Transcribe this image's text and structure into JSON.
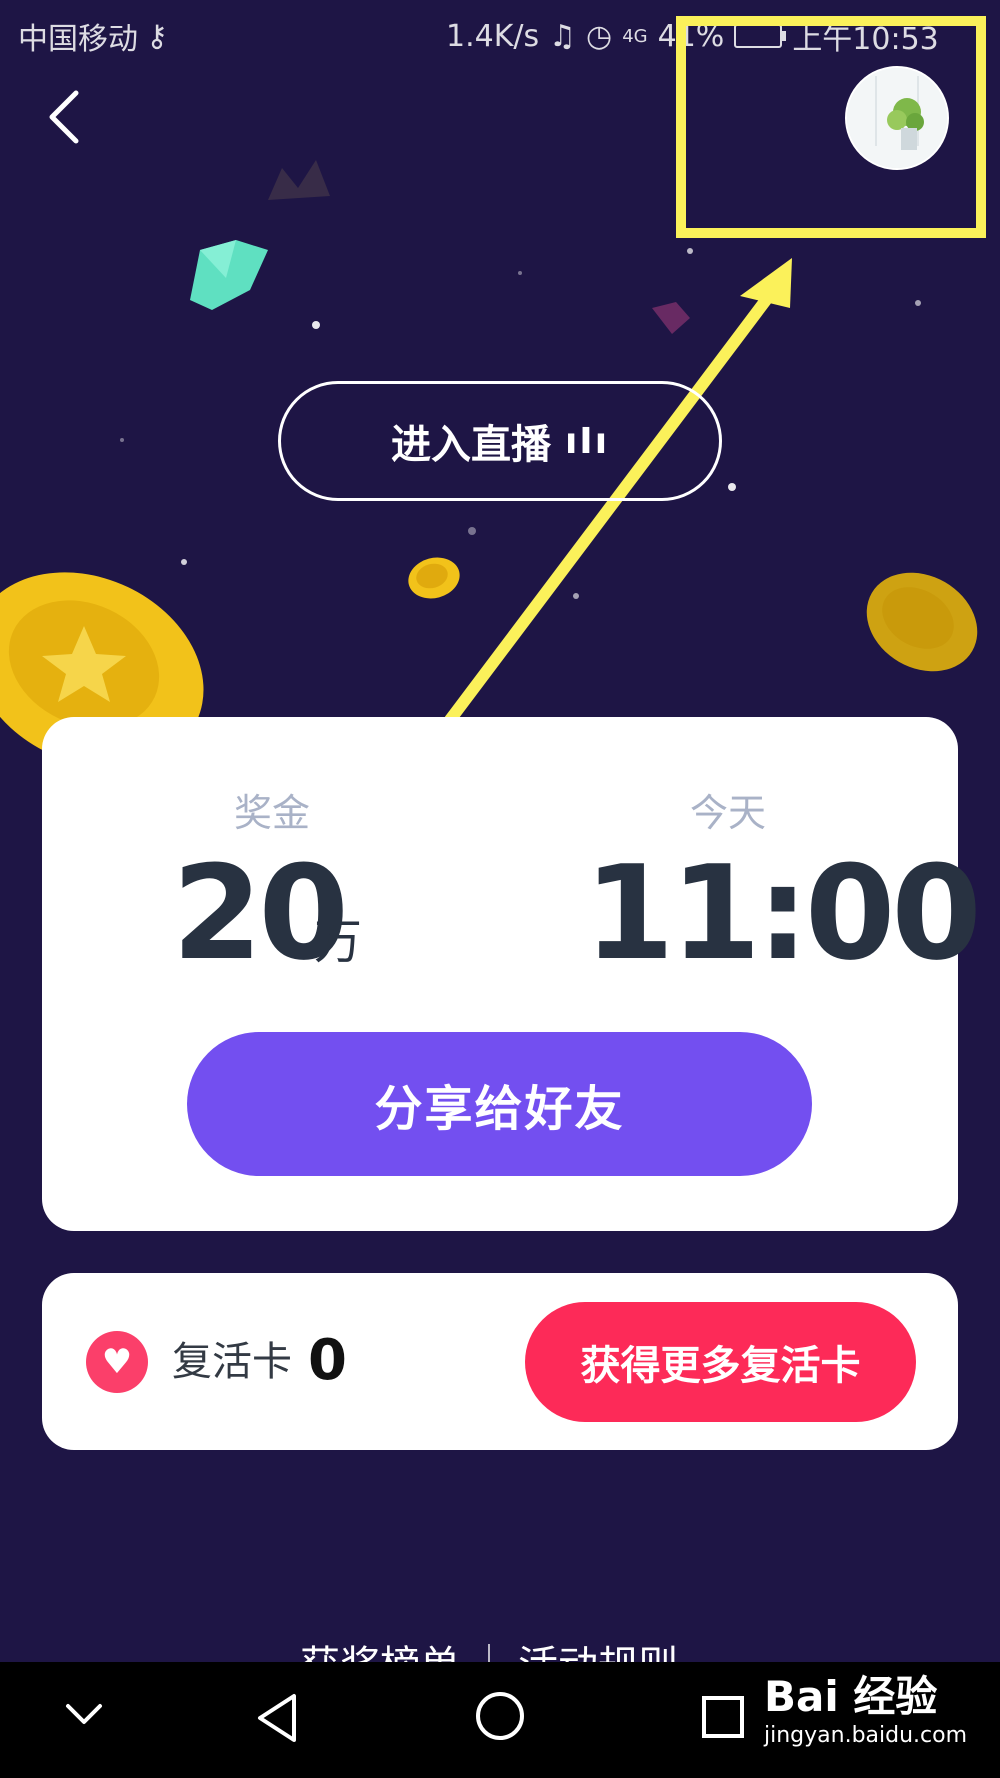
{
  "status_bar": {
    "carrier": "中国移动",
    "speed": "1.4K/s",
    "battery": "41%",
    "time": "上午10:53"
  },
  "header": {
    "back_icon": "chevron-left-icon",
    "avatar_icon": "user-avatar"
  },
  "live": {
    "label": "进入直播",
    "icon": "waveform-icon"
  },
  "main_card": {
    "prize_label": "奖金",
    "prize_amount": "20",
    "prize_unit": "万",
    "time_label": "今天",
    "time_value": "11:00",
    "share_label": "分享给好友"
  },
  "revive": {
    "icon": "heart-icon",
    "label": "复活卡",
    "count": "0",
    "get_more_label": "获得更多复活卡"
  },
  "bottom_links": {
    "left": "获奖榜单",
    "right": "活动规则"
  },
  "nav": {
    "down_icon": "chevron-down-icon",
    "back_icon": "triangle-back-icon",
    "home_icon": "circle-home-icon",
    "recent_icon": "square-recent-icon"
  },
  "watermark": {
    "main": "Bai 经验",
    "sub": "jingyan.baidu.com"
  },
  "colors": {
    "background": "#1e1545",
    "share_button": "#734ff0",
    "get_more_button": "#fd2a58",
    "heart": "#fb3f6a",
    "highlight": "#fbf15a"
  }
}
